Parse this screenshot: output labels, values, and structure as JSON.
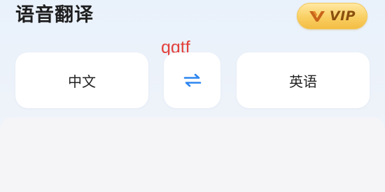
{
  "header": {
    "title": "语音翻译",
    "vip_label": "VIP"
  },
  "watermark": "qqtf",
  "languages": {
    "source": "中文",
    "target": "英语"
  },
  "icons": {
    "vip_logo": "v-crown-icon",
    "swap": "swap-arrows-icon"
  },
  "colors": {
    "vip_gold": "#f9cf62",
    "vip_text": "#8a4f0e",
    "swap_blue": "#2e86f0",
    "watermark": "#e2413c"
  }
}
